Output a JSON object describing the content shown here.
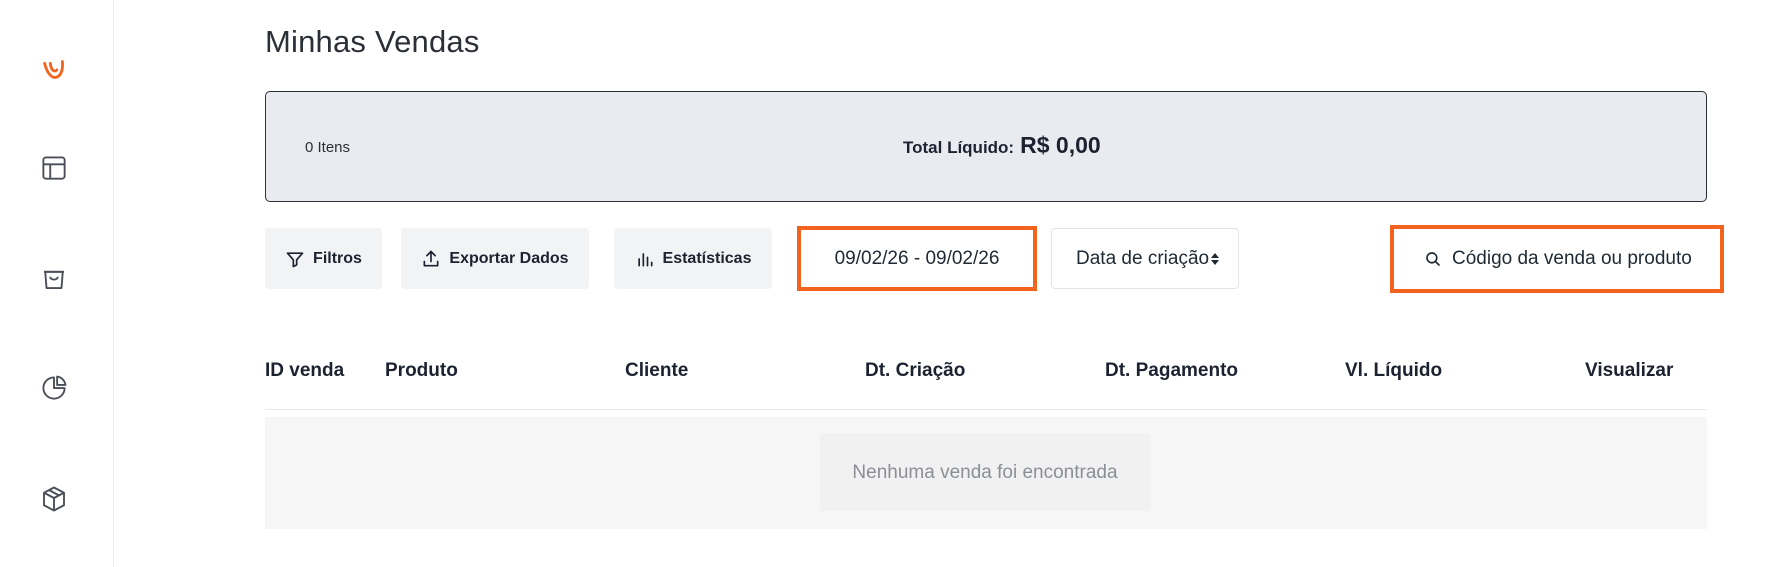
{
  "sidebar": {
    "items": [
      {
        "icon": "brand-logo-icon"
      },
      {
        "icon": "layout-icon"
      },
      {
        "icon": "shopping-bag-icon"
      },
      {
        "icon": "pie-chart-icon"
      },
      {
        "icon": "package-icon"
      }
    ]
  },
  "page": {
    "title": "Minhas Vendas"
  },
  "summary": {
    "items_count": "0 Itens",
    "total_label": "Total Líquido:",
    "total_value": "R$ 0,00"
  },
  "toolbar": {
    "filters_label": "Filtros",
    "export_label": "Exportar Dados",
    "stats_label": "Estatísticas",
    "date_range": "09/02/26 - 09/02/26",
    "sort_value": "Data de criação",
    "search_placeholder": "Código da venda ou produto"
  },
  "table": {
    "columns": [
      "ID venda",
      "Produto",
      "Cliente",
      "Dt. Criação",
      "Dt. Pagamento",
      "Vl. Líquido",
      "Visualizar"
    ],
    "empty_message": "Nenhuma venda foi encontrada"
  },
  "colors": {
    "accent": "#f2641e",
    "summary_bg": "#e9ebf1",
    "button_bg": "#f2f3f4",
    "text_dark": "#1c2230"
  }
}
